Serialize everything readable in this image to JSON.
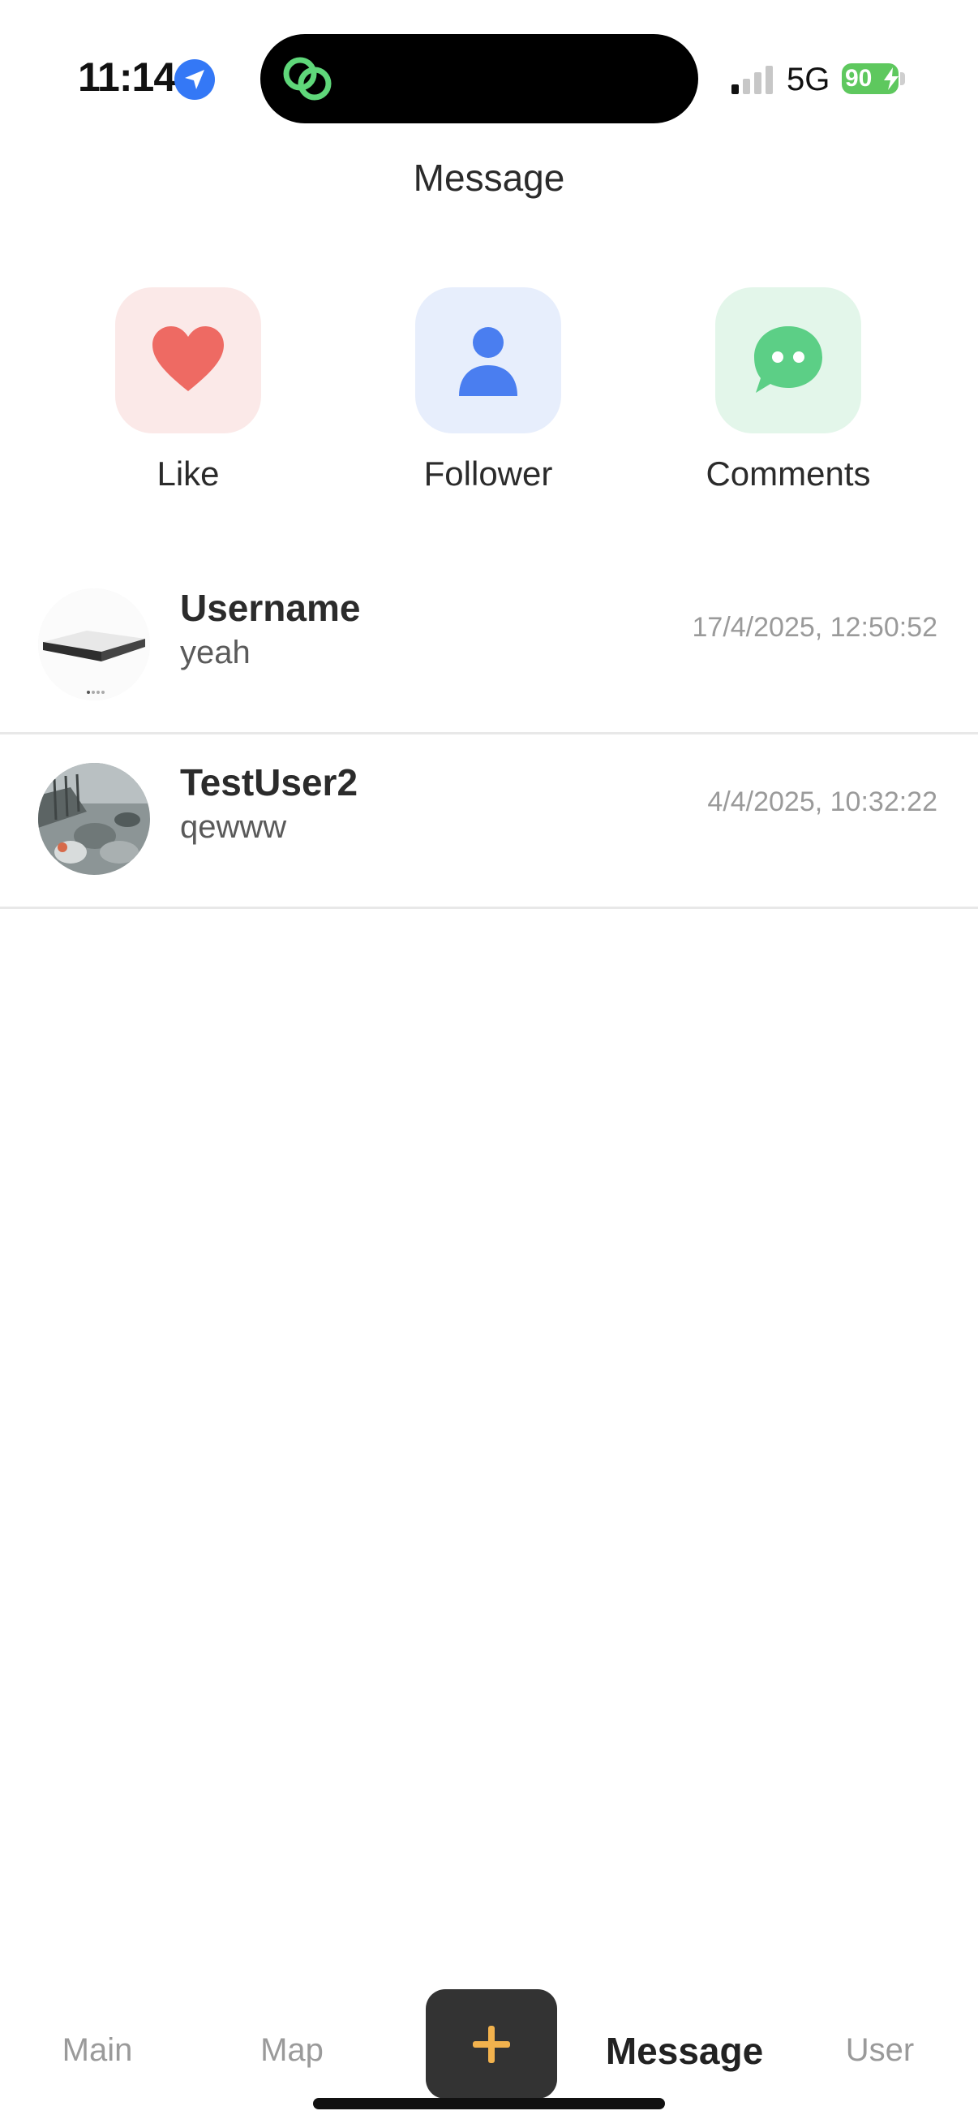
{
  "status_bar": {
    "time": "11:14",
    "network": "5G",
    "battery": "90",
    "icons": [
      "location-arrow-icon",
      "linked-rings-app-icon",
      "signal-bars-icon",
      "battery-charging-icon"
    ]
  },
  "header": {
    "title": "Message"
  },
  "quick_actions": [
    {
      "label": "Like",
      "icon": "heart-icon",
      "color": "#ee6a63"
    },
    {
      "label": "Follower",
      "icon": "person-icon",
      "color": "#4a7ef0"
    },
    {
      "label": "Comments",
      "icon": "chat-bubble-icon",
      "color": "#5ccf86"
    }
  ],
  "messages": [
    {
      "name": "Username",
      "preview": "yeah",
      "time": "17/4/2025, 12:50:52",
      "avatar": "mattress-photo-avatar"
    },
    {
      "name": "TestUser2",
      "preview": "qewww",
      "time": "4/4/2025, 10:32:22",
      "avatar": "birds-photo-avatar"
    }
  ],
  "tab_bar": {
    "tabs": [
      "Main",
      "Map",
      "Message",
      "User"
    ],
    "active": "Message",
    "add_icon": "plus-icon",
    "add_icon_color": "#f2b24d"
  }
}
